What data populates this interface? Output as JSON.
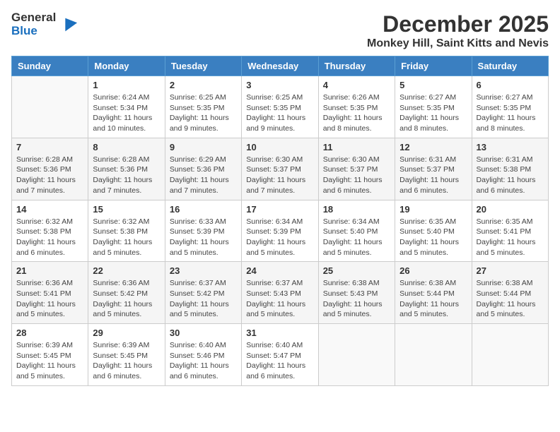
{
  "logo": {
    "general": "General",
    "blue": "Blue"
  },
  "title": "December 2025",
  "location": "Monkey Hill, Saint Kitts and Nevis",
  "headers": [
    "Sunday",
    "Monday",
    "Tuesday",
    "Wednesday",
    "Thursday",
    "Friday",
    "Saturday"
  ],
  "weeks": [
    [
      {
        "day": "",
        "info": ""
      },
      {
        "day": "1",
        "info": "Sunrise: 6:24 AM\nSunset: 5:34 PM\nDaylight: 11 hours\nand 10 minutes."
      },
      {
        "day": "2",
        "info": "Sunrise: 6:25 AM\nSunset: 5:35 PM\nDaylight: 11 hours\nand 9 minutes."
      },
      {
        "day": "3",
        "info": "Sunrise: 6:25 AM\nSunset: 5:35 PM\nDaylight: 11 hours\nand 9 minutes."
      },
      {
        "day": "4",
        "info": "Sunrise: 6:26 AM\nSunset: 5:35 PM\nDaylight: 11 hours\nand 8 minutes."
      },
      {
        "day": "5",
        "info": "Sunrise: 6:27 AM\nSunset: 5:35 PM\nDaylight: 11 hours\nand 8 minutes."
      },
      {
        "day": "6",
        "info": "Sunrise: 6:27 AM\nSunset: 5:35 PM\nDaylight: 11 hours\nand 8 minutes."
      }
    ],
    [
      {
        "day": "7",
        "info": "Sunrise: 6:28 AM\nSunset: 5:36 PM\nDaylight: 11 hours\nand 7 minutes."
      },
      {
        "day": "8",
        "info": "Sunrise: 6:28 AM\nSunset: 5:36 PM\nDaylight: 11 hours\nand 7 minutes."
      },
      {
        "day": "9",
        "info": "Sunrise: 6:29 AM\nSunset: 5:36 PM\nDaylight: 11 hours\nand 7 minutes."
      },
      {
        "day": "10",
        "info": "Sunrise: 6:30 AM\nSunset: 5:37 PM\nDaylight: 11 hours\nand 7 minutes."
      },
      {
        "day": "11",
        "info": "Sunrise: 6:30 AM\nSunset: 5:37 PM\nDaylight: 11 hours\nand 6 minutes."
      },
      {
        "day": "12",
        "info": "Sunrise: 6:31 AM\nSunset: 5:37 PM\nDaylight: 11 hours\nand 6 minutes."
      },
      {
        "day": "13",
        "info": "Sunrise: 6:31 AM\nSunset: 5:38 PM\nDaylight: 11 hours\nand 6 minutes."
      }
    ],
    [
      {
        "day": "14",
        "info": "Sunrise: 6:32 AM\nSunset: 5:38 PM\nDaylight: 11 hours\nand 6 minutes."
      },
      {
        "day": "15",
        "info": "Sunrise: 6:32 AM\nSunset: 5:38 PM\nDaylight: 11 hours\nand 5 minutes."
      },
      {
        "day": "16",
        "info": "Sunrise: 6:33 AM\nSunset: 5:39 PM\nDaylight: 11 hours\nand 5 minutes."
      },
      {
        "day": "17",
        "info": "Sunrise: 6:34 AM\nSunset: 5:39 PM\nDaylight: 11 hours\nand 5 minutes."
      },
      {
        "day": "18",
        "info": "Sunrise: 6:34 AM\nSunset: 5:40 PM\nDaylight: 11 hours\nand 5 minutes."
      },
      {
        "day": "19",
        "info": "Sunrise: 6:35 AM\nSunset: 5:40 PM\nDaylight: 11 hours\nand 5 minutes."
      },
      {
        "day": "20",
        "info": "Sunrise: 6:35 AM\nSunset: 5:41 PM\nDaylight: 11 hours\nand 5 minutes."
      }
    ],
    [
      {
        "day": "21",
        "info": "Sunrise: 6:36 AM\nSunset: 5:41 PM\nDaylight: 11 hours\nand 5 minutes."
      },
      {
        "day": "22",
        "info": "Sunrise: 6:36 AM\nSunset: 5:42 PM\nDaylight: 11 hours\nand 5 minutes."
      },
      {
        "day": "23",
        "info": "Sunrise: 6:37 AM\nSunset: 5:42 PM\nDaylight: 11 hours\nand 5 minutes."
      },
      {
        "day": "24",
        "info": "Sunrise: 6:37 AM\nSunset: 5:43 PM\nDaylight: 11 hours\nand 5 minutes."
      },
      {
        "day": "25",
        "info": "Sunrise: 6:38 AM\nSunset: 5:43 PM\nDaylight: 11 hours\nand 5 minutes."
      },
      {
        "day": "26",
        "info": "Sunrise: 6:38 AM\nSunset: 5:44 PM\nDaylight: 11 hours\nand 5 minutes."
      },
      {
        "day": "27",
        "info": "Sunrise: 6:38 AM\nSunset: 5:44 PM\nDaylight: 11 hours\nand 5 minutes."
      }
    ],
    [
      {
        "day": "28",
        "info": "Sunrise: 6:39 AM\nSunset: 5:45 PM\nDaylight: 11 hours\nand 5 minutes."
      },
      {
        "day": "29",
        "info": "Sunrise: 6:39 AM\nSunset: 5:45 PM\nDaylight: 11 hours\nand 6 minutes."
      },
      {
        "day": "30",
        "info": "Sunrise: 6:40 AM\nSunset: 5:46 PM\nDaylight: 11 hours\nand 6 minutes."
      },
      {
        "day": "31",
        "info": "Sunrise: 6:40 AM\nSunset: 5:47 PM\nDaylight: 11 hours\nand 6 minutes."
      },
      {
        "day": "",
        "info": ""
      },
      {
        "day": "",
        "info": ""
      },
      {
        "day": "",
        "info": ""
      }
    ]
  ]
}
